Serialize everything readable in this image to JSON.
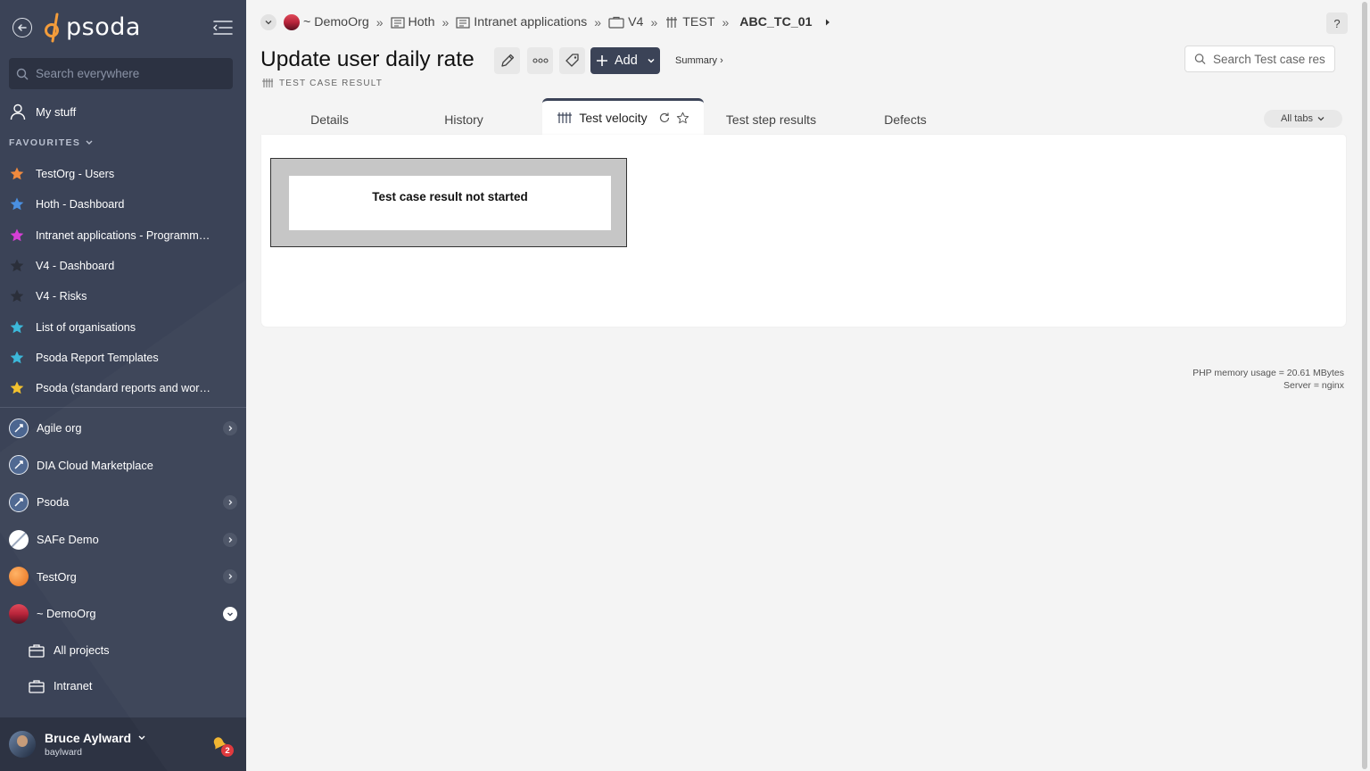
{
  "sidebar": {
    "logo_text": "psoda",
    "search_placeholder": "Search everywhere",
    "my_stuff_label": "My stuff",
    "favourites_heading": "FAVOURITES",
    "favourites": [
      {
        "label": "TestOrg - Users",
        "star_color": "#f08a3e"
      },
      {
        "label": "Hoth - Dashboard",
        "star_color": "#4a90e2"
      },
      {
        "label": "Intranet applications - Programme...",
        "star_color": "#d63fd6"
      },
      {
        "label": "V4 - Dashboard",
        "star_color": "#2b2f3a"
      },
      {
        "label": "V4 - Risks",
        "star_color": "#2b2f3a"
      },
      {
        "label": "List of organisations",
        "star_color": "#3cb8d9"
      },
      {
        "label": "Psoda Report Templates",
        "star_color": "#3cb8d9"
      },
      {
        "label": "Psoda (standard reports and work...",
        "star_color": "#f2c12e"
      }
    ],
    "orgs": [
      {
        "label": "Agile org",
        "icon": "rocket-icon",
        "expandable": true
      },
      {
        "label": "DIA Cloud Marketplace",
        "icon": "rocket-icon",
        "expandable": false
      },
      {
        "label": "Psoda",
        "icon": "rocket-icon",
        "expandable": true
      },
      {
        "label": "SAFe Demo",
        "icon": "safe-logo-icon",
        "expandable": true
      },
      {
        "label": "TestOrg",
        "icon": "orange-sphere-icon",
        "expandable": true
      },
      {
        "label": "~ DemoOrg",
        "icon": "sunset-icon",
        "expandable": true,
        "expanded": true
      }
    ],
    "sub_items": [
      {
        "label": "All projects",
        "icon": "briefcase-icon"
      },
      {
        "label": "Intranet",
        "icon": "briefcase-icon"
      }
    ],
    "user": {
      "name": "Bruce Aylward",
      "handle": "baylward",
      "notification_count": "2"
    }
  },
  "breadcrumb": {
    "items": [
      {
        "label": "~ DemoOrg",
        "icon": "sunset-icon"
      },
      {
        "label": "Hoth",
        "icon": "programme-icon"
      },
      {
        "label": "Intranet applications",
        "icon": "programme-icon"
      },
      {
        "label": "V4",
        "icon": "project-icon"
      },
      {
        "label": "TEST",
        "icon": "test-icon"
      },
      {
        "label": "ABC_TC_01",
        "icon": ""
      }
    ],
    "separator": "»"
  },
  "header": {
    "title": "Update user daily rate",
    "subtitle": "TEST CASE RESULT",
    "add_label": "Add",
    "summary_label": "Summary ›",
    "help_label": "?",
    "search_placeholder": "Search Test case res"
  },
  "tabs": {
    "items": [
      "Details",
      "History",
      "Test velocity",
      "Test step results",
      "Defects"
    ],
    "active": "Test velocity",
    "all_tabs_label": "All tabs"
  },
  "content": {
    "velocity_message": "Test case result not started"
  },
  "footer": {
    "memory": "PHP memory usage = 20.61 MBytes",
    "server": "Server = nginx"
  },
  "colors": {
    "sidebar_bg": "#3b4357",
    "accent": "#3b4357",
    "page_bg": "#f4f4f4"
  }
}
